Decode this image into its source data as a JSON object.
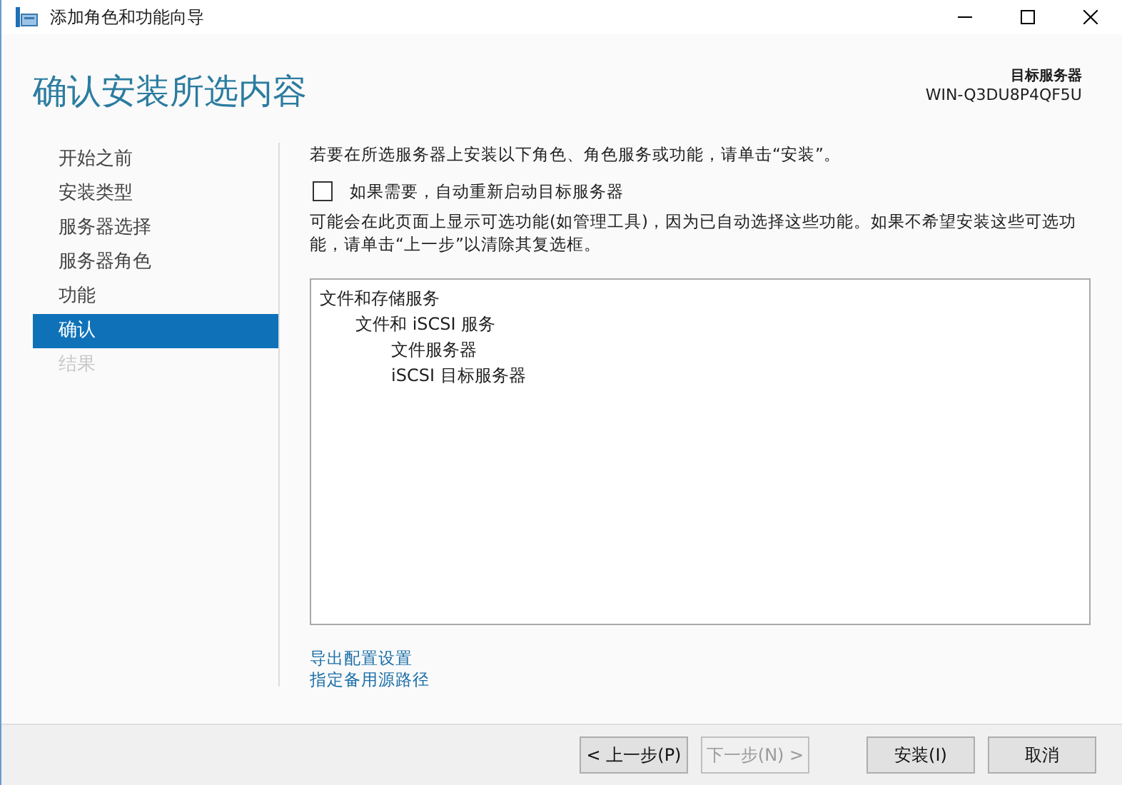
{
  "window": {
    "title": "添加角色和功能向导"
  },
  "header": {
    "title": "确认安装所选内容",
    "server_label": "目标服务器",
    "server_name": "WIN-Q3DU8P4QF5U"
  },
  "sidebar": {
    "items": [
      {
        "label": "开始之前",
        "selected": false,
        "disabled": false
      },
      {
        "label": "安装类型",
        "selected": false,
        "disabled": false
      },
      {
        "label": "服务器选择",
        "selected": false,
        "disabled": false
      },
      {
        "label": "服务器角色",
        "selected": false,
        "disabled": false
      },
      {
        "label": "功能",
        "selected": false,
        "disabled": false
      },
      {
        "label": "确认",
        "selected": true,
        "disabled": false
      },
      {
        "label": "结果",
        "selected": false,
        "disabled": true
      }
    ]
  },
  "content": {
    "intro": "若要在所选服务器上安装以下角色、角色服务或功能，请单击“安装”。",
    "restart_checkbox": {
      "label": "如果需要，自动重新启动目标服务器",
      "checked": false
    },
    "note": "可能会在此页面上显示可选功能(如管理工具)，因为已自动选择这些功能。如果不希望安装这些可选功能，请单击“上一步”以清除其复选框。",
    "tree": [
      {
        "label": "文件和存储服务",
        "children": [
          {
            "label": "文件和 iSCSI 服务",
            "children": [
              {
                "label": "文件服务器"
              },
              {
                "label": "iSCSI 目标服务器"
              }
            ]
          }
        ]
      }
    ],
    "links": [
      "导出配置设置",
      "指定备用源路径"
    ]
  },
  "buttons": [
    {
      "label": "< 上一步(P)",
      "disabled": false
    },
    {
      "label": "下一步(N) >",
      "disabled": true
    },
    {
      "label": "安装(I)",
      "disabled": false
    },
    {
      "label": "取消",
      "disabled": false
    }
  ]
}
